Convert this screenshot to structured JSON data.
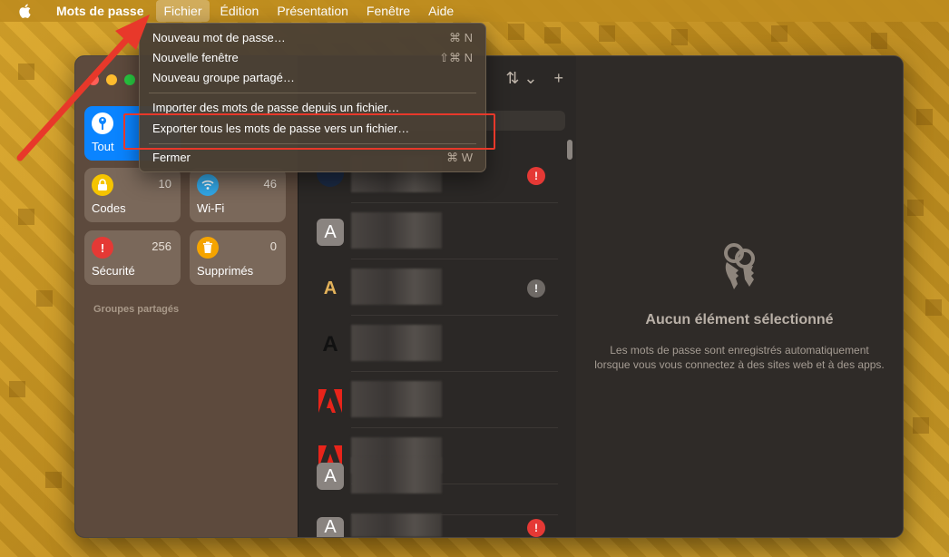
{
  "menubar": {
    "app_name": "Mots de passe",
    "items": [
      "Fichier",
      "Édition",
      "Présentation",
      "Fenêtre",
      "Aide"
    ],
    "active": "Fichier"
  },
  "file_menu": {
    "items": [
      {
        "label": "Nouveau mot de passe…",
        "shortcut": "⌘ N"
      },
      {
        "label": "Nouvelle fenêtre",
        "shortcut": "⇧⌘ N"
      },
      {
        "label": "Nouveau groupe partagé…",
        "shortcut": ""
      },
      {
        "label": "Importer des mots de passe depuis un fichier…",
        "shortcut": ""
      },
      {
        "label": "Exporter tous les mots de passe vers un fichier…",
        "shortcut": ""
      },
      {
        "label": "Fermer",
        "shortcut": "⌘ W"
      }
    ]
  },
  "sidebar": {
    "tiles": [
      {
        "label": "Tout",
        "count": "",
        "icon": "key-icon",
        "color": "#0a84ff"
      },
      {
        "label": "Codes",
        "count": "10",
        "icon": "lock-icon",
        "color": "#f5c400"
      },
      {
        "label": "Wi-Fi",
        "count": "46",
        "icon": "wifi-icon",
        "color": "#32a7e6"
      },
      {
        "label": "Sécurité",
        "count": "256",
        "icon": "exclamation-icon",
        "color": "#e53935"
      },
      {
        "label": "Supprimés",
        "count": "0",
        "icon": "trash-icon",
        "color": "#f5a400"
      }
    ],
    "section_title": "Groupes partagés"
  },
  "list": {
    "toolbar": {
      "sort_icon": "sort-icon",
      "add_icon": "plus-icon"
    },
    "rows": [
      {
        "avatar": "",
        "warning": "red"
      },
      {
        "avatar": "A",
        "warning": ""
      },
      {
        "avatar": "A",
        "warning": "gray"
      },
      {
        "avatar": "A",
        "warning": ""
      },
      {
        "avatar": "adobe",
        "warning": ""
      },
      {
        "avatar": "adobe",
        "warning": ""
      },
      {
        "avatar": "A",
        "warning": ""
      },
      {
        "avatar": "A",
        "warning": "red"
      }
    ]
  },
  "detail": {
    "title": "Aucun élément sélectionné",
    "description": "Les mots de passe sont enregistrés automatiquement lorsque vous vous connectez à des sites web et à des apps."
  },
  "colors": {
    "accent": "#0a84ff",
    "highlight": "#e8382a",
    "warning_red": "#e53935"
  }
}
